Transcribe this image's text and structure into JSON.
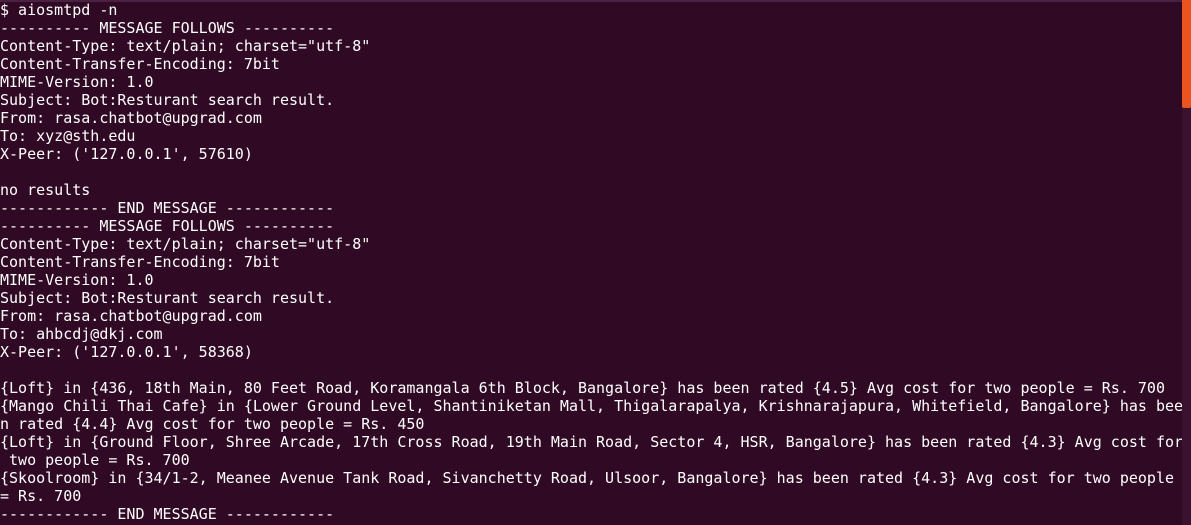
{
  "terminal": {
    "lines": [
      "$ aiosmtpd -n",
      "---------- MESSAGE FOLLOWS ----------",
      "Content-Type: text/plain; charset=\"utf-8\"",
      "Content-Transfer-Encoding: 7bit",
      "MIME-Version: 1.0",
      "Subject: Bot:Resturant search result.",
      "From: rasa.chatbot@upgrad.com",
      "To: xyz@sth.edu",
      "X-Peer: ('127.0.0.1', 57610)",
      "",
      "no results",
      "------------ END MESSAGE ------------",
      "---------- MESSAGE FOLLOWS ----------",
      "Content-Type: text/plain; charset=\"utf-8\"",
      "Content-Transfer-Encoding: 7bit",
      "MIME-Version: 1.0",
      "Subject: Bot:Resturant search result.",
      "From: rasa.chatbot@upgrad.com",
      "To: ahbcdj@dkj.com",
      "X-Peer: ('127.0.0.1', 58368)",
      "",
      "{Loft} in {436, 18th Main, 80 Feet Road, Koramangala 6th Block, Bangalore} has been rated {4.5} Avg cost for two people = Rs. 700",
      "{Mango Chili Thai Cafe} in {Lower Ground Level, Shantiniketan Mall, Thigalarapalya, Krishnarajapura, Whitefield, Bangalore} has bee",
      "n rated {4.4} Avg cost for two people = Rs. 450",
      "{Loft} in {Ground Floor, Shree Arcade, 17th Cross Road, 19th Main Road, Sector 4, HSR, Bangalore} has been rated {4.3} Avg cost for",
      " two people = Rs. 700",
      "{Skoolroom} in {34/1-2, Meanee Avenue Tank Road, Sivanchetty Road, Ulsoor, Bangalore} has been rated {4.3} Avg cost for two people",
      "= Rs. 700",
      "------------ END MESSAGE ------------"
    ]
  },
  "colors": {
    "background": "#300a24",
    "text": "#ffffff",
    "scrollbar_thumb": "#e95420"
  }
}
